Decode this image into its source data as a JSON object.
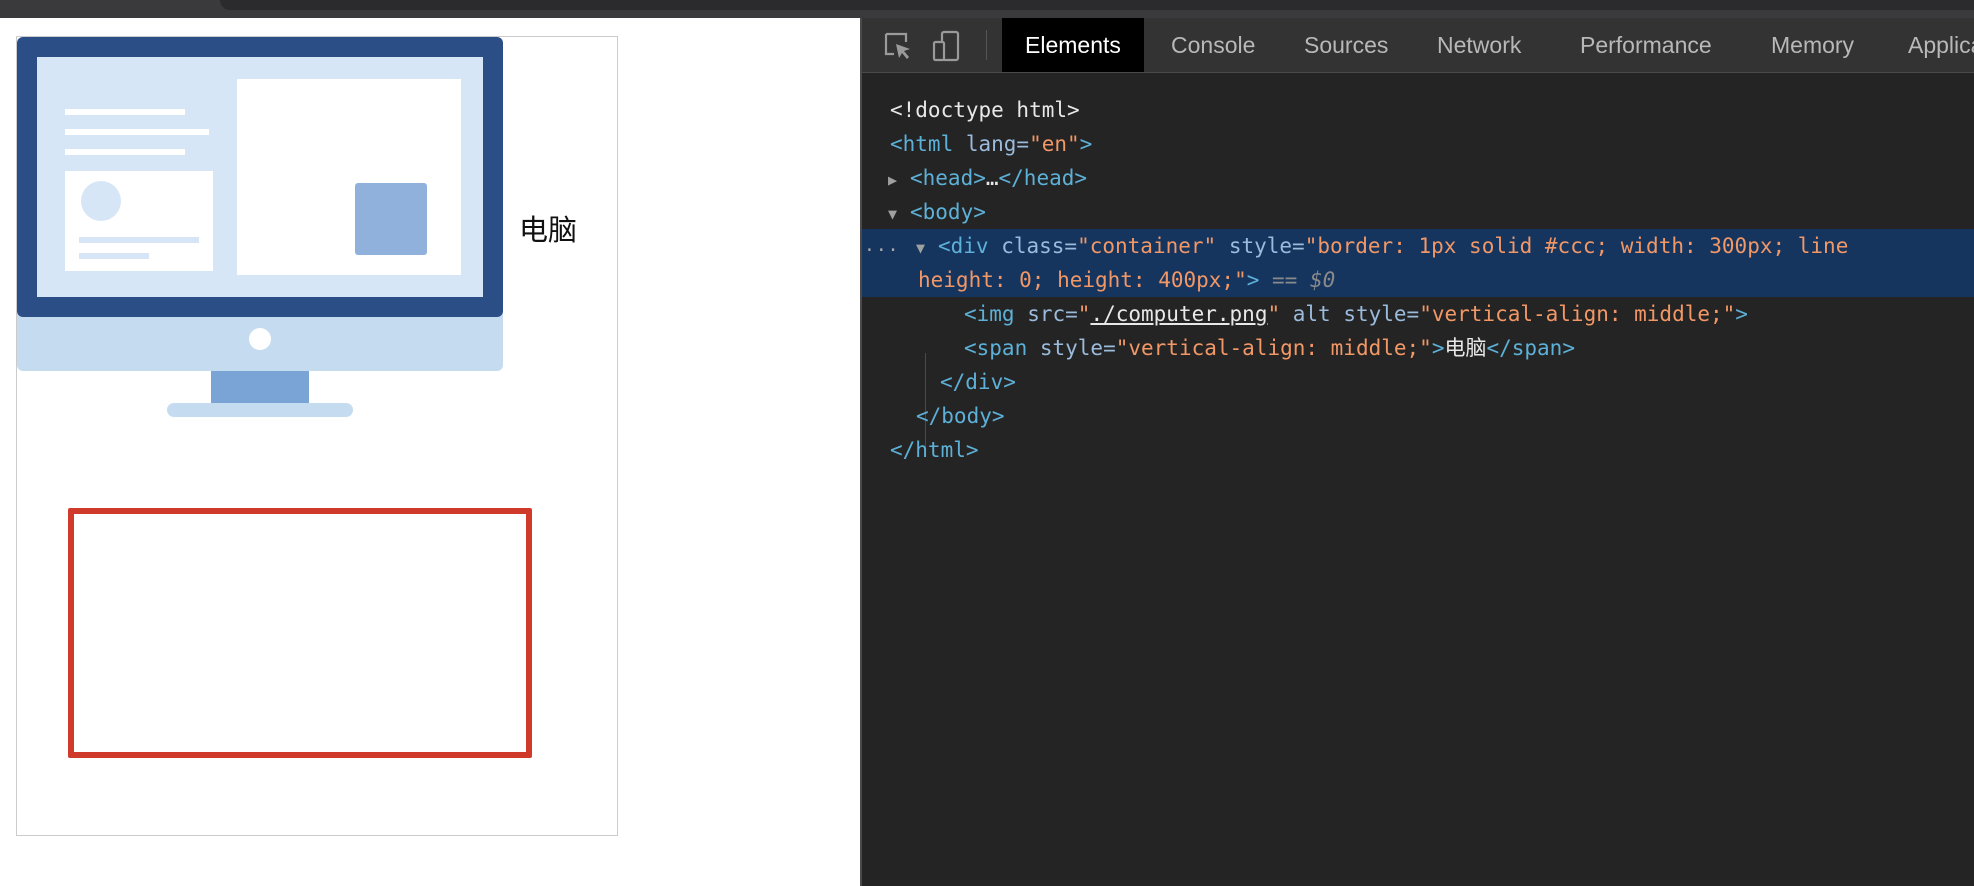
{
  "page": {
    "label_text": "电脑"
  },
  "devtools": {
    "tabs": [
      "Elements",
      "Console",
      "Sources",
      "Network",
      "Performance",
      "Memory",
      "Applica"
    ],
    "active_tab": "Elements",
    "icons": [
      "inspect-element-icon",
      "device-toolbar-icon"
    ],
    "code": {
      "doctype": "<!doctype html>",
      "html_open": "<html",
      "lang_attr": " lang=",
      "lang_val": "\"en\"",
      "gt": ">",
      "head_collapsed": "<head>",
      "head_ellipsis": "…",
      "head_close": "</head>",
      "body_open": "<body>",
      "div_open": "<div",
      "class_attr": " class=",
      "class_val": "\"container\"",
      "style_attr": " style=",
      "div_style_val_1": "\"border: 1px solid #ccc; width: 300px; line",
      "div_style_val_2": "height: 0; height: 400px;\"",
      "div_tail": ">",
      "equals_ref": " == $0",
      "img_open": "<img",
      "src_attr": " src=",
      "src_q1": "\"",
      "src_val": "./computer.png",
      "src_q2": "\"",
      "alt_attr": " alt",
      "img_style_val": "\"vertical-align: middle;\"",
      "span_open": "<span",
      "span_style_val": "\"vertical-align: middle;\"",
      "span_text": "电脑",
      "span_close": "</span>",
      "div_close": "</div>",
      "body_close": "</body>",
      "html_close": "</html>",
      "dots": "..."
    }
  },
  "colors": {
    "devtools_bg": "#242424",
    "selected_row": "#15355f",
    "tag": "#5db0d7",
    "attr_name": "#9bbbdc",
    "attr_value": "#f29766",
    "red_box_border": "#d03a2a",
    "container_border": "#cccccc"
  }
}
